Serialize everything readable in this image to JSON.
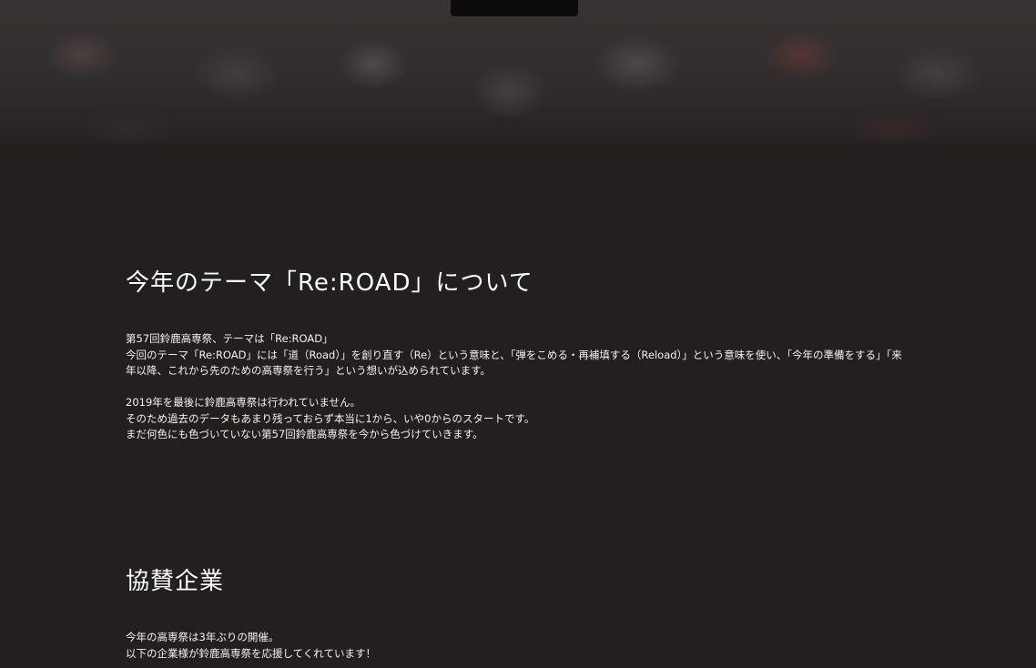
{
  "theme_section": {
    "heading": "今年のテーマ「Re:ROAD」について",
    "lines": [
      "第57回鈴鹿高専祭、テーマは「Re:ROAD」",
      "今回のテーマ「Re:ROAD」には「道（Road）」を創り直す（Re）という意味と、「弾をこめる・再補填する（Reload）」という意味を使い、「今年の準備をする」「来年以降、これから先のための高専祭を行う」という想いが込められています。",
      "2019年を最後に鈴鹿高専祭は行われていません。",
      "そのため過去のデータもあまり残っておらず本当に1から、いや0からのスタートです。",
      "まだ何色にも色づいていない第57回鈴鹿高専祭を今から色づけていきます。"
    ]
  },
  "sponsor_section": {
    "heading": "協賛企業",
    "lines": [
      "今年の高専祭は3年ぶりの開催。",
      "以下の企業様が鈴鹿高専祭を応援してくれています！"
    ]
  }
}
